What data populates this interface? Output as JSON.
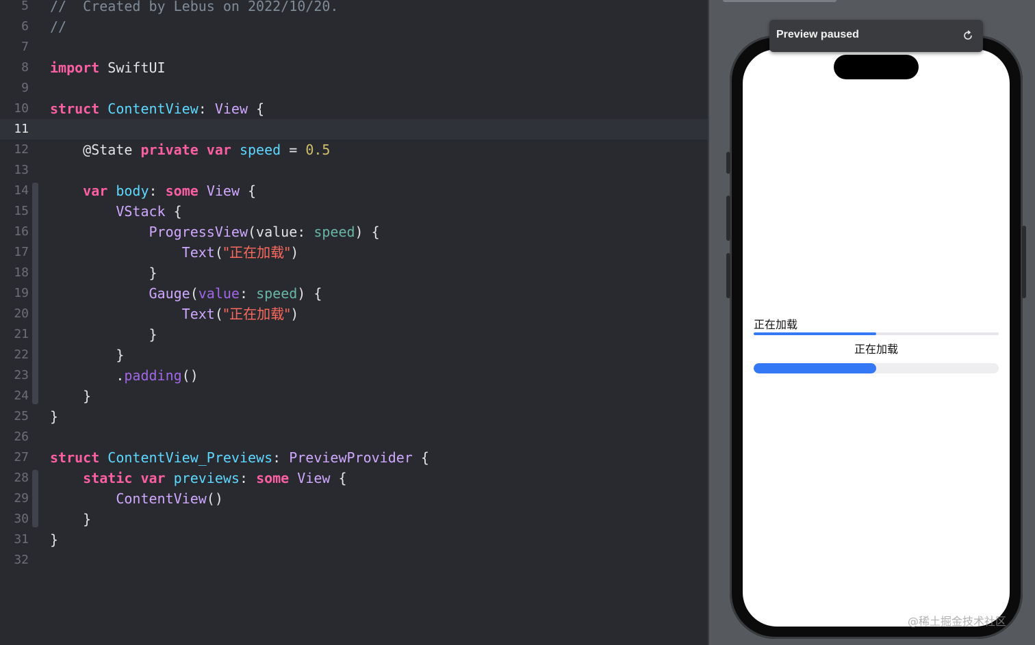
{
  "editor": {
    "current_line": 11,
    "lines": [
      {
        "n": "5",
        "tokens": [
          {
            "t": "//  Created by Lebus on 2022/10/20.",
            "c": "cmt"
          }
        ]
      },
      {
        "n": "6",
        "tokens": [
          {
            "t": "//",
            "c": "cmt"
          }
        ]
      },
      {
        "n": "7",
        "tokens": []
      },
      {
        "n": "8",
        "tokens": [
          {
            "t": "import",
            "c": "kw"
          },
          {
            "t": " SwiftUI",
            "c": "txt"
          }
        ]
      },
      {
        "n": "9",
        "tokens": []
      },
      {
        "n": "10",
        "tokens": [
          {
            "t": "struct",
            "c": "kw"
          },
          {
            "t": " ",
            "c": "txt"
          },
          {
            "t": "ContentView",
            "c": "tn"
          },
          {
            "t": ": ",
            "c": "txt"
          },
          {
            "t": "View",
            "c": "typ"
          },
          {
            "t": " {",
            "c": "txt"
          }
        ]
      },
      {
        "n": "11",
        "tokens": []
      },
      {
        "n": "12",
        "tokens": [
          {
            "t": "    @State ",
            "c": "txt"
          },
          {
            "t": "private",
            "c": "kw"
          },
          {
            "t": " ",
            "c": "txt"
          },
          {
            "t": "var",
            "c": "kw"
          },
          {
            "t": " ",
            "c": "txt"
          },
          {
            "t": "speed",
            "c": "tn"
          },
          {
            "t": " = ",
            "c": "txt"
          },
          {
            "t": "0.5",
            "c": "num"
          }
        ]
      },
      {
        "n": "13",
        "tokens": []
      },
      {
        "n": "14",
        "tokens": [
          {
            "t": "    ",
            "c": "txt"
          },
          {
            "t": "var",
            "c": "kw"
          },
          {
            "t": " ",
            "c": "txt"
          },
          {
            "t": "body",
            "c": "tn"
          },
          {
            "t": ": ",
            "c": "txt"
          },
          {
            "t": "some",
            "c": "kw"
          },
          {
            "t": " ",
            "c": "txt"
          },
          {
            "t": "View",
            "c": "typ"
          },
          {
            "t": " {",
            "c": "txt"
          }
        ]
      },
      {
        "n": "15",
        "tokens": [
          {
            "t": "        ",
            "c": "txt"
          },
          {
            "t": "VStack",
            "c": "typ"
          },
          {
            "t": " {",
            "c": "txt"
          }
        ]
      },
      {
        "n": "16",
        "tokens": [
          {
            "t": "            ",
            "c": "txt"
          },
          {
            "t": "ProgressView",
            "c": "typ"
          },
          {
            "t": "(value: ",
            "c": "txt"
          },
          {
            "t": "speed",
            "c": "prop"
          },
          {
            "t": ") {",
            "c": "txt"
          }
        ]
      },
      {
        "n": "17",
        "tokens": [
          {
            "t": "                ",
            "c": "txt"
          },
          {
            "t": "Text",
            "c": "typ"
          },
          {
            "t": "(",
            "c": "txt"
          },
          {
            "t": "\"正在加载\"",
            "c": "str"
          },
          {
            "t": ")",
            "c": "txt"
          }
        ]
      },
      {
        "n": "18",
        "tokens": [
          {
            "t": "            }",
            "c": "txt"
          }
        ]
      },
      {
        "n": "19",
        "tokens": [
          {
            "t": "            ",
            "c": "txt"
          },
          {
            "t": "Gauge",
            "c": "typ"
          },
          {
            "t": "(",
            "c": "txt"
          },
          {
            "t": "value",
            "c": "fn"
          },
          {
            "t": ": ",
            "c": "txt"
          },
          {
            "t": "speed",
            "c": "prop"
          },
          {
            "t": ") {",
            "c": "txt"
          }
        ]
      },
      {
        "n": "20",
        "tokens": [
          {
            "t": "                ",
            "c": "txt"
          },
          {
            "t": "Text",
            "c": "typ"
          },
          {
            "t": "(",
            "c": "txt"
          },
          {
            "t": "\"正在加载\"",
            "c": "str"
          },
          {
            "t": ")",
            "c": "txt"
          }
        ]
      },
      {
        "n": "21",
        "tokens": [
          {
            "t": "            }",
            "c": "txt"
          }
        ]
      },
      {
        "n": "22",
        "tokens": [
          {
            "t": "        }",
            "c": "txt"
          }
        ]
      },
      {
        "n": "23",
        "tokens": [
          {
            "t": "        .",
            "c": "txt"
          },
          {
            "t": "padding",
            "c": "fn"
          },
          {
            "t": "()",
            "c": "txt"
          }
        ]
      },
      {
        "n": "24",
        "tokens": [
          {
            "t": "    }",
            "c": "txt"
          }
        ]
      },
      {
        "n": "25",
        "tokens": [
          {
            "t": "}",
            "c": "txt"
          }
        ]
      },
      {
        "n": "26",
        "tokens": []
      },
      {
        "n": "27",
        "tokens": [
          {
            "t": "struct",
            "c": "kw"
          },
          {
            "t": " ",
            "c": "txt"
          },
          {
            "t": "ContentView_Previews",
            "c": "tn"
          },
          {
            "t": ": ",
            "c": "txt"
          },
          {
            "t": "PreviewProvider",
            "c": "typ"
          },
          {
            "t": " {",
            "c": "txt"
          }
        ]
      },
      {
        "n": "28",
        "tokens": [
          {
            "t": "    ",
            "c": "txt"
          },
          {
            "t": "static",
            "c": "kw"
          },
          {
            "t": " ",
            "c": "txt"
          },
          {
            "t": "var",
            "c": "kw"
          },
          {
            "t": " ",
            "c": "txt"
          },
          {
            "t": "previews",
            "c": "tn"
          },
          {
            "t": ": ",
            "c": "txt"
          },
          {
            "t": "some",
            "c": "kw"
          },
          {
            "t": " ",
            "c": "txt"
          },
          {
            "t": "View",
            "c": "typ"
          },
          {
            "t": " {",
            "c": "txt"
          }
        ]
      },
      {
        "n": "29",
        "tokens": [
          {
            "t": "        ",
            "c": "txt"
          },
          {
            "t": "ContentView",
            "c": "typ"
          },
          {
            "t": "()",
            "c": "txt"
          }
        ]
      },
      {
        "n": "30",
        "tokens": [
          {
            "t": "    }",
            "c": "txt"
          }
        ]
      },
      {
        "n": "31",
        "tokens": [
          {
            "t": "}",
            "c": "txt"
          }
        ]
      },
      {
        "n": "32",
        "tokens": []
      }
    ]
  },
  "preview": {
    "banner_title": "Preview paused",
    "refresh_icon": "refresh-icon",
    "progress_label": "正在加载",
    "progress_value": 0.5,
    "gauge_label": "正在加载",
    "gauge_value": 0.5,
    "accent_color": "#3478f6"
  },
  "watermark": "@稀土掘金技术社区"
}
